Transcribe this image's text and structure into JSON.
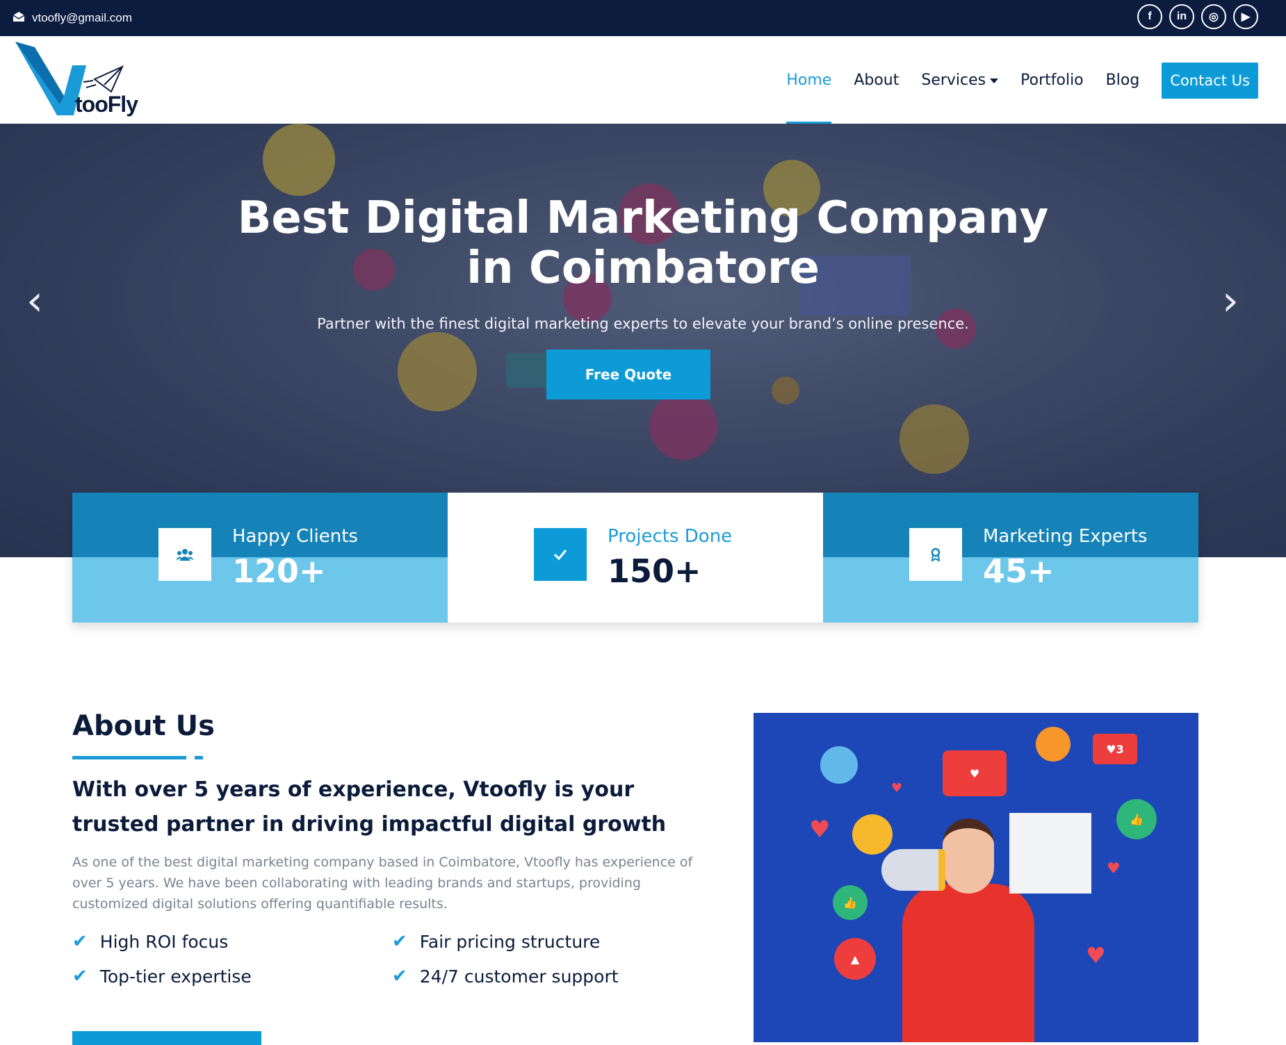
{
  "topbar": {
    "email": "vtoofly@gmail.com",
    "social": [
      {
        "icon": "facebook-icon",
        "glyph": "f"
      },
      {
        "icon": "linkedin-icon",
        "glyph": "in"
      },
      {
        "icon": "instagram-icon",
        "glyph": "◎"
      },
      {
        "icon": "youtube-icon",
        "glyph": "▶"
      }
    ]
  },
  "brand": {
    "logo_text": "tooFly"
  },
  "nav": {
    "items": [
      "Home",
      "About",
      "Services",
      "Portfolio",
      "Blog"
    ],
    "active": "Home",
    "contact": "Contact Us"
  },
  "hero": {
    "title_line1": "Best Digital Marketing Company",
    "title_line2": "in Coimbatore",
    "subtitle": "Partner with the finest digital marketing experts to elevate your brand’s online presence.",
    "cta": "Free Quote",
    "prev": "‹",
    "next": "›"
  },
  "stats": [
    {
      "label": "Happy Clients",
      "value": "120+",
      "icon": "users-icon"
    },
    {
      "label": "Projects Done",
      "value": "150+",
      "icon": "check-icon"
    },
    {
      "label": "Marketing Experts",
      "value": "45+",
      "icon": "award-icon"
    }
  ],
  "about": {
    "title": "About Us",
    "headline": "With over 5 years of experience, Vtoofly is your trusted partner in driving impactful digital growth",
    "body": "As one of the best digital marketing company based in Coimbatore, Vtoofly has experience of over 5 years. We have been collaborating with leading brands and startups, providing customized digital solutions offering quantifiable results.",
    "features": [
      "High ROI focus",
      "Fair pricing structure",
      "Top-tier expertise",
      "24/7 customer support"
    ]
  },
  "colors": {
    "navy": "#0b1c3f",
    "accent": "#0d9bd7",
    "light_blue": "#6cc7ea",
    "image_bg": "#1d47b6"
  }
}
